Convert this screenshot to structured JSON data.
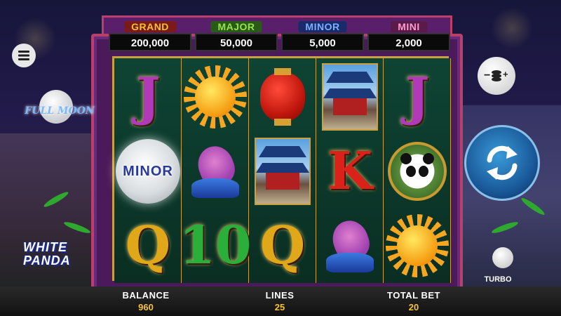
{
  "jackpots": [
    {
      "label": "GRAND",
      "value": "200,000",
      "label_color": "#f2c230",
      "label_bg": "#7a1a1a"
    },
    {
      "label": "MAJOR",
      "value": "50,000",
      "label_color": "#9ae04a",
      "label_bg": "#2a5a1a"
    },
    {
      "label": "MINOR",
      "value": "5,000",
      "label_color": "#7ab0ff",
      "label_bg": "#1a2a6a"
    },
    {
      "label": "MINI",
      "value": "2,000",
      "label_color": "#ff9ad0",
      "label_bg": "#5a1a4a"
    }
  ],
  "reels": [
    [
      "letter-j",
      "moon-minor",
      "letter-q"
    ],
    [
      "sun",
      "koi",
      "letter-10"
    ],
    [
      "lantern",
      "temple",
      "letter-q"
    ],
    [
      "temple",
      "letter-k",
      "koi"
    ],
    [
      "letter-j",
      "panda",
      "sun"
    ]
  ],
  "symbols": {
    "letter_j": "J",
    "letter_k": "K",
    "letter_q": "Q",
    "letter_10": "10",
    "moon_label": "MINOR"
  },
  "symbol_colors": {
    "letter_j": "#b03ab8",
    "letter_k": "#d8221a",
    "letter_q": "#e0a818",
    "letter_10": "#2ab03a"
  },
  "logos": {
    "full_moon": "FULL MOON",
    "white_panda_line1": "WHITE",
    "white_panda_line2": "PANDA"
  },
  "controls": {
    "menu_icon": "hamburger-icon",
    "coins_icon": "coins-bet-icon",
    "spin_icon": "spin-arrows-icon",
    "turbo_label": "TURBO"
  },
  "bottom": {
    "balance_label": "BALANCE",
    "balance_value": "960",
    "lines_label": "LINES",
    "lines_value": "25",
    "total_bet_label": "TOTAL BET",
    "total_bet_value": "20"
  },
  "colors": {
    "accent_gold": "#f6c436",
    "frame_pink": "#b8406a",
    "spin_blue": "#1a5a9a"
  }
}
